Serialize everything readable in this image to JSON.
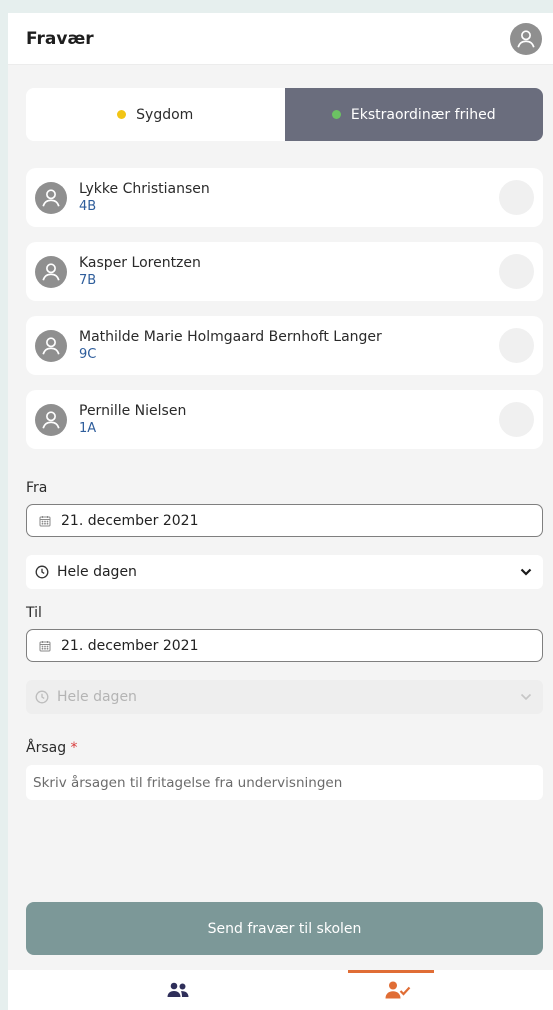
{
  "header": {
    "title": "Fravær",
    "avatar_icon": "user-avatar-icon"
  },
  "segment": {
    "options": [
      {
        "label": "Sygdom",
        "dot_color": "#f2c515",
        "active": false
      },
      {
        "label": "Ekstraordinær frihed",
        "dot_color": "#6cc263",
        "active": true
      }
    ]
  },
  "students": [
    {
      "name": "Lykke Christiansen",
      "class": "4B"
    },
    {
      "name": "Kasper Lorentzen",
      "class": "7B"
    },
    {
      "name": "Mathilde Marie Holmgaard Bernhoft Langer",
      "class": "9C"
    },
    {
      "name": "Pernille Nielsen",
      "class": "1A"
    }
  ],
  "from": {
    "label": "Fra",
    "date": "21. december 2021",
    "time": "Hele dagen"
  },
  "to": {
    "label": "Til",
    "date": "21. december 2021",
    "time": "Hele dagen"
  },
  "reason": {
    "label": "Årsag",
    "required_mark": "*",
    "placeholder": "Skriv årsagen til fritagelse fra undervisningen"
  },
  "submit": {
    "label": "Send fravær til skolen"
  },
  "colors": {
    "accent": "#e06d35",
    "submit_bg": "#7c9898",
    "segment_active_bg": "#6a6d7d",
    "class_text": "#2e5d9b"
  },
  "tabbar": {
    "tabs": [
      {
        "icon": "users-icon",
        "active": false
      },
      {
        "icon": "user-check-icon",
        "active": true
      }
    ]
  }
}
